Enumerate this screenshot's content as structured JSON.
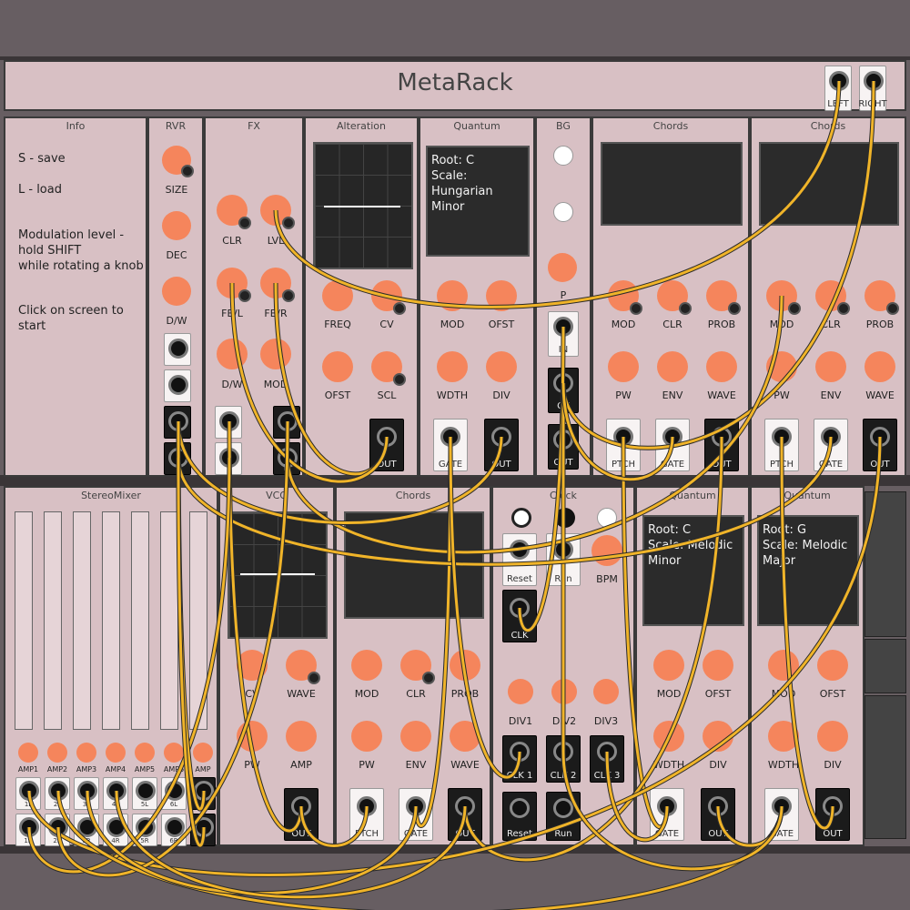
{
  "app_title": "MetaRack",
  "header": {
    "outputs": [
      {
        "label": "LEFT"
      },
      {
        "label": "RIGHT"
      }
    ]
  },
  "info": {
    "title": "Info",
    "lines": [
      "S - save",
      "L - load",
      "Modulation level -",
      "hold SHIFT",
      "while rotating a knob",
      "Click on screen to start"
    ]
  },
  "rvr": {
    "title": "RVR",
    "knobs": [
      "SIZE",
      "DEC",
      "D/W"
    ]
  },
  "fx": {
    "title": "FX",
    "knobs": [
      "CLR",
      "LVL",
      "FB/L",
      "FB/R",
      "D/W",
      "MOD"
    ],
    "jacks": [
      "",
      "",
      "",
      "R"
    ]
  },
  "alteration": {
    "title": "Alteration",
    "knobs": [
      "FREQ",
      "CV",
      "OFST",
      "SCL"
    ],
    "out": "OUT"
  },
  "quantum1": {
    "title": "Quantum",
    "screen": [
      "Root: C",
      "Scale: Hungarian",
      "Minor"
    ],
    "knobs": [
      "MOD",
      "OFST",
      "WDTH",
      "DIV"
    ],
    "jacks": [
      "GATE",
      "OUT"
    ]
  },
  "bg": {
    "title": "BG",
    "knob": "P",
    "jacks": [
      "IN",
      "CV",
      "OUT"
    ]
  },
  "chords1": {
    "title": "Chords",
    "knobs": [
      "MOD",
      "CLR",
      "PROB",
      "PW",
      "ENV",
      "WAVE"
    ],
    "jacks": [
      "PTCH",
      "GATE",
      "OUT"
    ]
  },
  "chords2": {
    "title": "Chords",
    "knobs": [
      "MOD",
      "CLR",
      "PROB",
      "PW",
      "ENV",
      "WAVE"
    ],
    "jacks": [
      "PTCH",
      "GATE",
      "OUT"
    ]
  },
  "stereomixer": {
    "title": "StereoMixer",
    "amps": [
      "AMP1",
      "AMP2",
      "AMP3",
      "AMP4",
      "AMP5",
      "AMP6",
      "AMP"
    ],
    "left_jacks": [
      "1L",
      "2L",
      "3L",
      "4L",
      "5L",
      "6L",
      ""
    ],
    "right_jacks": [
      "1R",
      "2R",
      "3R",
      "4R",
      "5R",
      "6R",
      ""
    ]
  },
  "vco": {
    "title": "VCO",
    "knobs": [
      "CV",
      "WAVE",
      "PW",
      "AMP"
    ],
    "out": "OUT"
  },
  "chords3": {
    "title": "Chords",
    "knobs": [
      "MOD",
      "CLR",
      "PROB",
      "PW",
      "ENV",
      "WAVE"
    ],
    "jacks": [
      "PTCH",
      "GATE",
      "OUT"
    ]
  },
  "clock": {
    "title": "Clock",
    "buttons": [
      "Reset",
      "Run"
    ],
    "bpm": "BPM",
    "clk": "CLK",
    "divs": [
      "DIV1",
      "DIV2",
      "DIV3"
    ],
    "clk_outs": [
      "CLK 1",
      "CLK 2",
      "CLK 3"
    ],
    "bottom": [
      "Reset",
      "Run"
    ]
  },
  "quantum2": {
    "title": "Quantum",
    "screen": [
      "Root: C",
      "Scale: Melodic",
      "Minor"
    ],
    "knobs": [
      "MOD",
      "OFST",
      "WDTH",
      "DIV"
    ],
    "jacks": [
      "GATE",
      "OUT"
    ]
  },
  "quantum3": {
    "title": "Quantum",
    "screen": [
      "Root: G",
      "Scale: Melodic",
      "Major"
    ],
    "knobs": [
      "MOD",
      "OFST",
      "WDTH",
      "DIV"
    ],
    "jacks": [
      "GATE",
      "OUT"
    ]
  },
  "colors": {
    "background": "#675e62",
    "panel": "#d8c0c4",
    "knob": "#f5855c",
    "cable": "#f0b429",
    "cable_outline": "#2a2a2a"
  },
  "cables": [
    {
      "from": "header.left",
      "to": "fx.lvl"
    },
    {
      "from": "header.right",
      "to": "bg.cv"
    },
    {
      "from": "chords2.mod",
      "to": "fx.jack4"
    },
    {
      "from": "alteration.out",
      "to": "fx.fbr"
    },
    {
      "from": "alteration.out",
      "to": "fx.fbl"
    },
    {
      "from": "quantum1.gate",
      "to": "chords3.gate"
    },
    {
      "from": "quantum1.out",
      "to": "rvr.jack3"
    },
    {
      "from": "bg.in",
      "to": "clock.clk"
    },
    {
      "from": "bg.cv",
      "to": "clock.clk2"
    },
    {
      "from": "chords1.ptch",
      "to": "quantum2.gate"
    },
    {
      "from": "chords1.gate",
      "to": "bg.cv"
    },
    {
      "from": "chords1.out",
      "to": "chords3.out"
    },
    {
      "from": "chords2.gate",
      "to": "rvr.jack4"
    },
    {
      "from": "chords2.ptch",
      "to": "quantum3.out"
    },
    {
      "from": "chords2.out",
      "to": "stereomixer.1l"
    },
    {
      "from": "fx.jack1",
      "to": "vco.out"
    },
    {
      "from": "fx.jack2",
      "to": "stereomixer.1r"
    },
    {
      "from": "fx.jack3",
      "to": "stereomixer.2r"
    },
    {
      "from": "rvr.jack3",
      "to": "stereomixer.amp7"
    },
    {
      "from": "rvr.jack4",
      "to": "stereomixer.7r"
    },
    {
      "from": "quantum1.gate",
      "to": "clock.clk1"
    },
    {
      "from": "quantum3.gate",
      "to": "stereomixer.2l"
    },
    {
      "from": "quantum3.gate",
      "to": "quantum2.out"
    },
    {
      "from": "vco.out",
      "to": "chords3.ptch"
    },
    {
      "from": "clock.clk2",
      "to": "quantum3.gate"
    },
    {
      "from": "clock.clk3",
      "to": "quantum2.gate"
    },
    {
      "from": "chords3.gate",
      "to": "stereomixer.3l"
    },
    {
      "from": "chords3.out",
      "to": "stereomixer.4l"
    }
  ]
}
